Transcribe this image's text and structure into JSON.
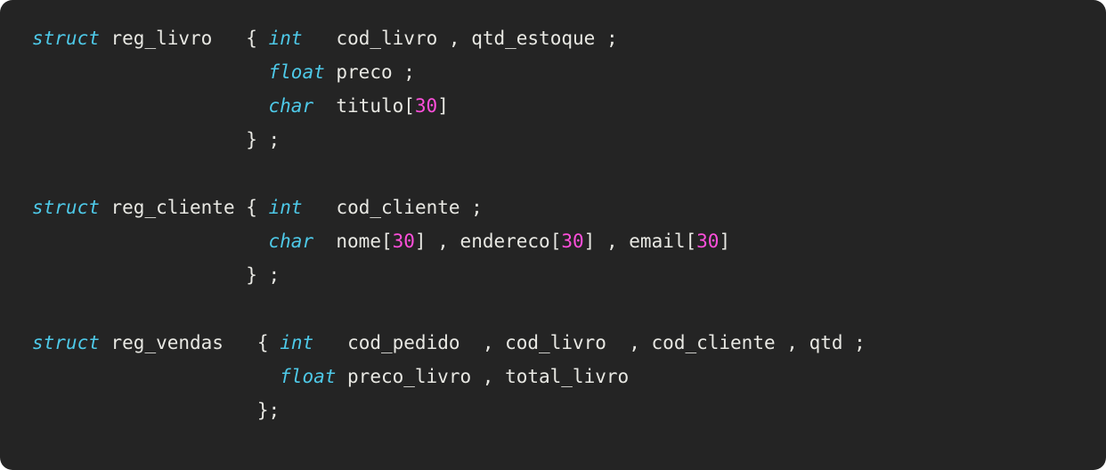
{
  "editor": {
    "language": "c",
    "background_color": "#242424",
    "keyword_color": "#4ec9e8",
    "number_color": "#ff4fdb",
    "text_color": "#e8e8e3",
    "page_background_color": "#ffffff"
  },
  "code": {
    "full_text": "struct reg_livro   { int   cod_livro , qtd_estoque ;\n                     float preco ;\n                     char  titulo[30]\n                   } ;\n\nstruct reg_cliente { int   cod_cliente ;\n                     char  nome[30] , endereco[30] , email[30]\n                   } ;\n\nstruct reg_vendas   { int   cod_pedido  , cod_livro  , cod_cliente , qtd ;\n                      float preco_livro , total_livro\n                    };",
    "lines": [
      {
        "index": 0,
        "tokens": [
          {
            "kind": "kw",
            "text": "struct"
          },
          {
            "kind": "plain",
            "text": " "
          },
          {
            "kind": "id",
            "text": "reg_livro"
          },
          {
            "kind": "plain",
            "text": "   "
          },
          {
            "kind": "punct",
            "text": "{"
          },
          {
            "kind": "plain",
            "text": " "
          },
          {
            "kind": "type",
            "text": "int"
          },
          {
            "kind": "plain",
            "text": "   "
          },
          {
            "kind": "id",
            "text": "cod_livro"
          },
          {
            "kind": "plain",
            "text": " "
          },
          {
            "kind": "punct",
            "text": ","
          },
          {
            "kind": "plain",
            "text": " "
          },
          {
            "kind": "id",
            "text": "qtd_estoque"
          },
          {
            "kind": "plain",
            "text": " "
          },
          {
            "kind": "punct",
            "text": ";"
          }
        ]
      },
      {
        "index": 1,
        "tokens": [
          {
            "kind": "plain",
            "text": "                     "
          },
          {
            "kind": "type",
            "text": "float"
          },
          {
            "kind": "plain",
            "text": " "
          },
          {
            "kind": "id",
            "text": "preco"
          },
          {
            "kind": "plain",
            "text": " "
          },
          {
            "kind": "punct",
            "text": ";"
          }
        ]
      },
      {
        "index": 2,
        "tokens": [
          {
            "kind": "plain",
            "text": "                     "
          },
          {
            "kind": "type",
            "text": "char"
          },
          {
            "kind": "plain",
            "text": "  "
          },
          {
            "kind": "id",
            "text": "titulo"
          },
          {
            "kind": "punct",
            "text": "["
          },
          {
            "kind": "num",
            "text": "30"
          },
          {
            "kind": "punct",
            "text": "]"
          }
        ]
      },
      {
        "index": 3,
        "tokens": [
          {
            "kind": "plain",
            "text": "                   "
          },
          {
            "kind": "punct",
            "text": "}"
          },
          {
            "kind": "plain",
            "text": " "
          },
          {
            "kind": "punct",
            "text": ";"
          }
        ]
      },
      {
        "index": 4,
        "tokens": []
      },
      {
        "index": 5,
        "tokens": [
          {
            "kind": "kw",
            "text": "struct"
          },
          {
            "kind": "plain",
            "text": " "
          },
          {
            "kind": "id",
            "text": "reg_cliente"
          },
          {
            "kind": "plain",
            "text": " "
          },
          {
            "kind": "punct",
            "text": "{"
          },
          {
            "kind": "plain",
            "text": " "
          },
          {
            "kind": "type",
            "text": "int"
          },
          {
            "kind": "plain",
            "text": "   "
          },
          {
            "kind": "id",
            "text": "cod_cliente"
          },
          {
            "kind": "plain",
            "text": " "
          },
          {
            "kind": "punct",
            "text": ";"
          }
        ]
      },
      {
        "index": 6,
        "tokens": [
          {
            "kind": "plain",
            "text": "                     "
          },
          {
            "kind": "type",
            "text": "char"
          },
          {
            "kind": "plain",
            "text": "  "
          },
          {
            "kind": "id",
            "text": "nome"
          },
          {
            "kind": "punct",
            "text": "["
          },
          {
            "kind": "num",
            "text": "30"
          },
          {
            "kind": "punct",
            "text": "]"
          },
          {
            "kind": "plain",
            "text": " "
          },
          {
            "kind": "punct",
            "text": ","
          },
          {
            "kind": "plain",
            "text": " "
          },
          {
            "kind": "id",
            "text": "endereco"
          },
          {
            "kind": "punct",
            "text": "["
          },
          {
            "kind": "num",
            "text": "30"
          },
          {
            "kind": "punct",
            "text": "]"
          },
          {
            "kind": "plain",
            "text": " "
          },
          {
            "kind": "punct",
            "text": ","
          },
          {
            "kind": "plain",
            "text": " "
          },
          {
            "kind": "id",
            "text": "email"
          },
          {
            "kind": "punct",
            "text": "["
          },
          {
            "kind": "num",
            "text": "30"
          },
          {
            "kind": "punct",
            "text": "]"
          }
        ]
      },
      {
        "index": 7,
        "tokens": [
          {
            "kind": "plain",
            "text": "                   "
          },
          {
            "kind": "punct",
            "text": "}"
          },
          {
            "kind": "plain",
            "text": " "
          },
          {
            "kind": "punct",
            "text": ";"
          }
        ]
      },
      {
        "index": 8,
        "tokens": []
      },
      {
        "index": 9,
        "tokens": [
          {
            "kind": "kw",
            "text": "struct"
          },
          {
            "kind": "plain",
            "text": " "
          },
          {
            "kind": "id",
            "text": "reg_vendas"
          },
          {
            "kind": "plain",
            "text": "   "
          },
          {
            "kind": "punct",
            "text": "{"
          },
          {
            "kind": "plain",
            "text": " "
          },
          {
            "kind": "type",
            "text": "int"
          },
          {
            "kind": "plain",
            "text": "   "
          },
          {
            "kind": "id",
            "text": "cod_pedido"
          },
          {
            "kind": "plain",
            "text": "  "
          },
          {
            "kind": "punct",
            "text": ","
          },
          {
            "kind": "plain",
            "text": " "
          },
          {
            "kind": "id",
            "text": "cod_livro"
          },
          {
            "kind": "plain",
            "text": "  "
          },
          {
            "kind": "punct",
            "text": ","
          },
          {
            "kind": "plain",
            "text": " "
          },
          {
            "kind": "id",
            "text": "cod_cliente"
          },
          {
            "kind": "plain",
            "text": " "
          },
          {
            "kind": "punct",
            "text": ","
          },
          {
            "kind": "plain",
            "text": " "
          },
          {
            "kind": "id",
            "text": "qtd"
          },
          {
            "kind": "plain",
            "text": " "
          },
          {
            "kind": "punct",
            "text": ";"
          }
        ]
      },
      {
        "index": 10,
        "tokens": [
          {
            "kind": "plain",
            "text": "                      "
          },
          {
            "kind": "type",
            "text": "float"
          },
          {
            "kind": "plain",
            "text": " "
          },
          {
            "kind": "id",
            "text": "preco_livro"
          },
          {
            "kind": "plain",
            "text": " "
          },
          {
            "kind": "punct",
            "text": ","
          },
          {
            "kind": "plain",
            "text": " "
          },
          {
            "kind": "id",
            "text": "total_livro"
          }
        ]
      },
      {
        "index": 11,
        "tokens": [
          {
            "kind": "plain",
            "text": "                    "
          },
          {
            "kind": "punct",
            "text": "}"
          },
          {
            "kind": "punct",
            "text": ";"
          }
        ]
      }
    ]
  }
}
